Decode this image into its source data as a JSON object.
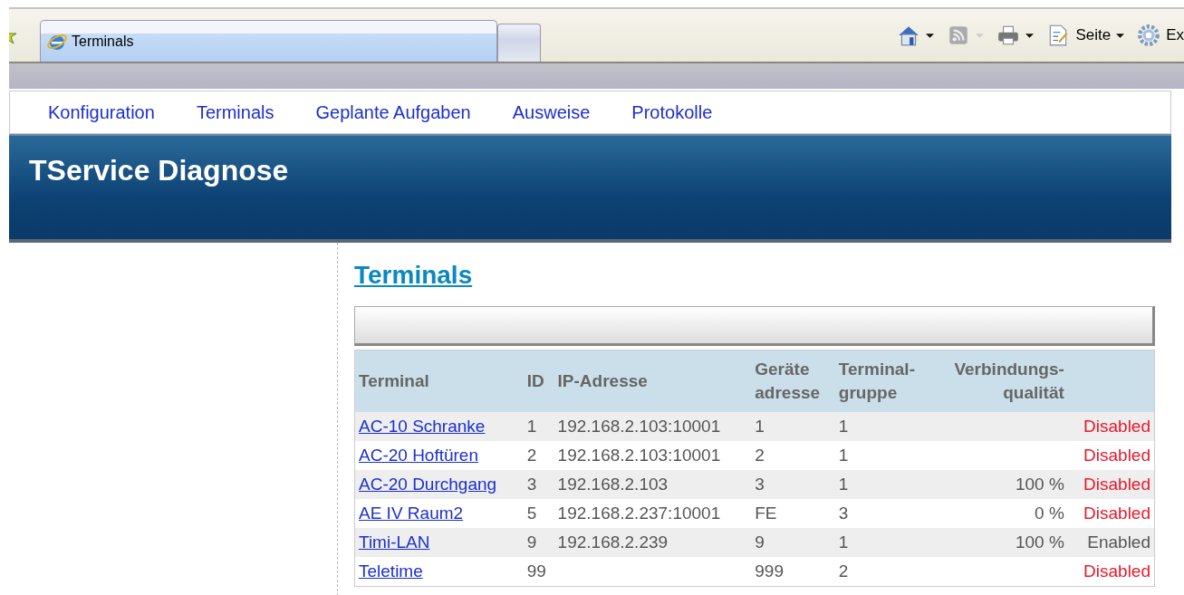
{
  "browser": {
    "tab_title": "Terminals",
    "toolbar": [
      {
        "kind": "home"
      },
      {
        "kind": "feed"
      },
      {
        "kind": "print"
      },
      {
        "kind": "page",
        "label": "Seite"
      },
      {
        "kind": "tools",
        "label": "Ex"
      }
    ]
  },
  "nav": [
    "Konfiguration",
    "Terminals",
    "Geplante Aufgaben",
    "Ausweise",
    "Protokolle"
  ],
  "header": {
    "title": "TService Diagnose"
  },
  "content": {
    "title": "Terminals",
    "table": {
      "columns": [
        {
          "lines": [
            "Terminal"
          ]
        },
        {
          "lines": [
            "ID"
          ]
        },
        {
          "lines": [
            "IP-Adresse"
          ]
        },
        {
          "lines": [
            "Geräte",
            "adresse"
          ]
        },
        {
          "lines": [
            "Terminal-",
            "gruppe"
          ]
        },
        {
          "lines": [
            "Verbindungs-",
            "qualität"
          ]
        }
      ],
      "rows": [
        {
          "terminal": "AC-10 Schranke",
          "id": "1",
          "ip": "192.168.2.103:10001",
          "address": "1",
          "group": "1",
          "status": "Disabled",
          "enabled": false
        },
        {
          "terminal": "AC-20 Hoftüren",
          "id": "2",
          "ip": "192.168.2.103:10001",
          "address": "2",
          "group": "1",
          "status": "Disabled",
          "enabled": false
        },
        {
          "terminal": "AC-20 Durchgang",
          "id": "3",
          "ip": "192.168.2.103",
          "address": "3",
          "group": "1",
          "quality": "100 %",
          "status": "Disabled",
          "enabled": false
        },
        {
          "terminal": "AE IV Raum2",
          "id": "5",
          "ip": "192.168.2.237:10001",
          "address": "FE",
          "group": "3",
          "quality": "0 %",
          "status": "Disabled",
          "enabled": false
        },
        {
          "terminal": "Timi-LAN",
          "id": "9",
          "ip": "192.168.2.239",
          "address": "9",
          "group": "1",
          "quality": "100 %",
          "status": "Enabled",
          "enabled": true
        },
        {
          "terminal": "Teletime",
          "id": "99",
          "address": "999",
          "group": "2",
          "status": "Disabled",
          "enabled": false
        }
      ]
    }
  }
}
